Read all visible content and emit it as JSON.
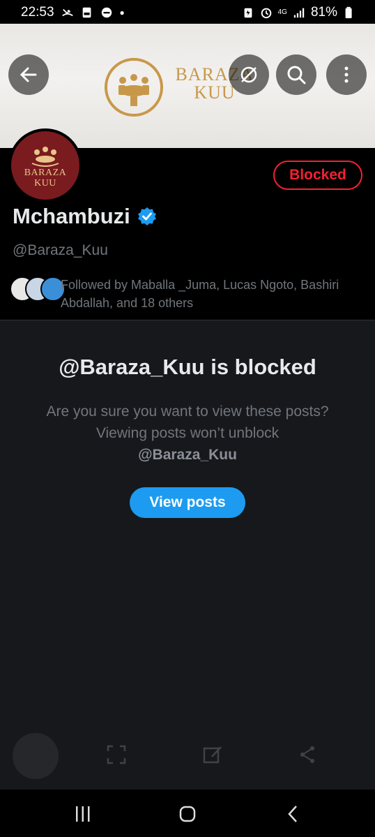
{
  "status_bar": {
    "time": "22:53",
    "battery": "81%",
    "network": "4G"
  },
  "banner": {
    "logo_line1": "BARAZA",
    "logo_line2": "KUU",
    "icons": [
      "back-arrow-icon",
      "grok-icon",
      "search-icon",
      "more-vertical-icon"
    ]
  },
  "profile": {
    "avatar_line1": "BARAZA",
    "avatar_line2": "KUU",
    "blocked_label": "Blocked",
    "display_name": "Mchambuzi",
    "handle": "@Baraza_Kuu",
    "followed_by": "Followed by Maballa _Juma, Lucas Ngoto, Bashiri Abdallah, and 18 others"
  },
  "blocked_notice": {
    "title": "@Baraza_Kuu is blocked",
    "description": "Are you sure you want to view these posts? Viewing posts won’t unblock",
    "description_handle": "@Baraza_Kuu",
    "button_label": "View posts"
  },
  "colors": {
    "accent": "#1d9bf0",
    "blocked": "#f4212e",
    "background": "#16181c",
    "avatar_bg": "#7a1b1f",
    "logo_gold": "#c8984a"
  }
}
